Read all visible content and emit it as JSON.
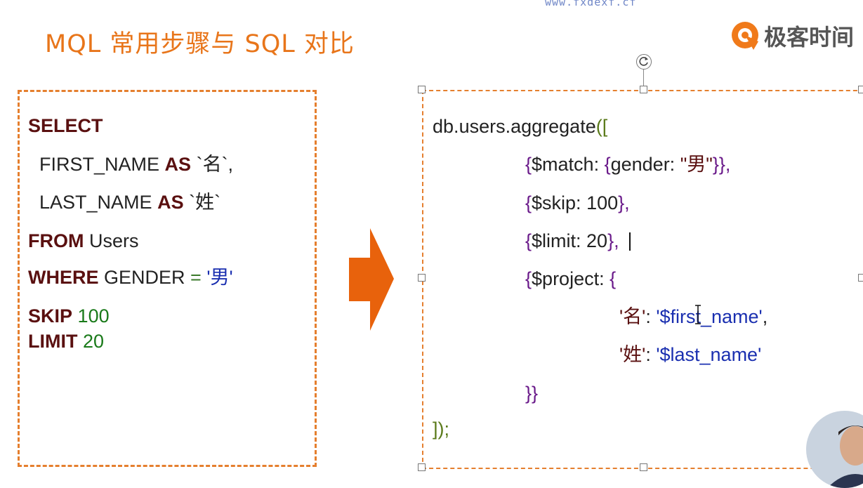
{
  "watermark": "www.fxdexf.cf",
  "title": "MQL 常用步骤与 SQL 对比",
  "brand": {
    "name": "极客时间",
    "logo_icon": "geektime-logo-icon"
  },
  "colors": {
    "accent": "#e8751a",
    "border": "#e57f2e",
    "keyword": "#5a1010",
    "string": "#1a2fb0",
    "number": "#1a7a1a"
  },
  "sql": {
    "select_kw": "SELECT",
    "first_name": "FIRST_NAME",
    "as1": "AS",
    "alias1": "`名`,",
    "last_name": "LAST_NAME",
    "as2": "AS",
    "alias2": "`姓`",
    "from_kw": "FROM",
    "from_table": "Users",
    "where_kw": "WHERE",
    "where_field": "GENDER",
    "where_op": "=",
    "where_value": "'男'",
    "skip_kw": "SKIP",
    "skip_value": "100",
    "limit_kw": "LIMIT",
    "limit_value": "20"
  },
  "mongo": {
    "line1_db": "db",
    "line1_dot1": ".",
    "line1_users": "users",
    "line1_dot2": ".",
    "line1_fn": "aggregate",
    "line1_open": "([",
    "match_open": "{",
    "match_key": "$match: ",
    "match_inner_open": "{",
    "match_field": "gender: ",
    "match_value": "\"男\"",
    "match_close": "}},",
    "skip_open": "{",
    "skip_text": "$skip: 100",
    "skip_close": "},",
    "limit_open": "{",
    "limit_text": "$limit: 20",
    "limit_close": "},",
    "project_open": "{",
    "project_key": "$project: ",
    "project_inner_open": "{",
    "p1_key": "'名'",
    "p1_colon": ": ",
    "p1_value": "'$first_name'",
    "p1_comma": ",",
    "p2_key": "'姓'",
    "p2_colon": ": ",
    "p2_value": "'$last_name'",
    "project_close": "}}",
    "end": "]);"
  }
}
